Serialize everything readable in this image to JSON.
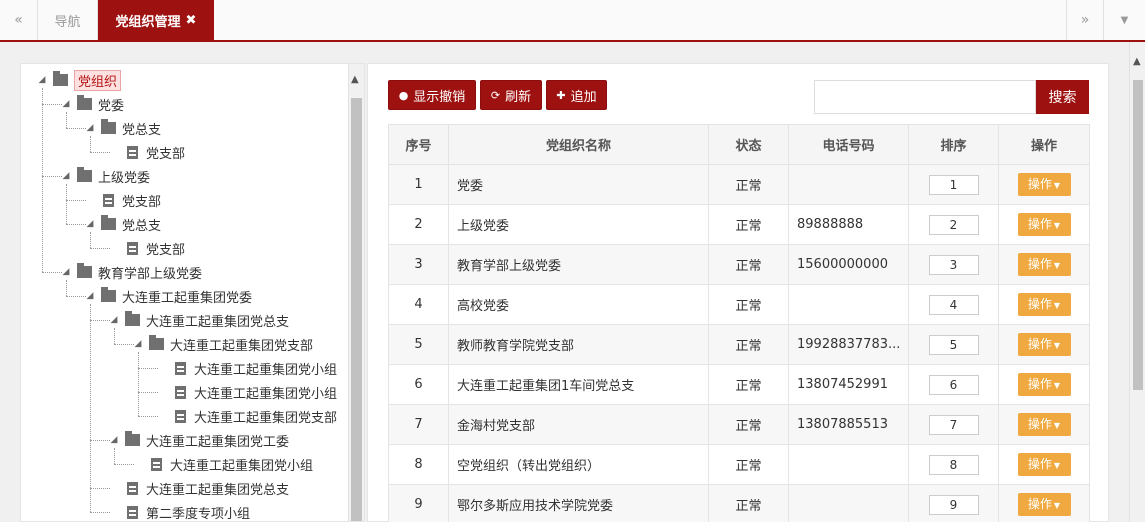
{
  "tabs": {
    "prev": "«",
    "nav": "导航",
    "active": "党组织管理",
    "close": "✖",
    "next": "»",
    "dropdown": "▼"
  },
  "toolbar": {
    "show_revoke": "显示撤销",
    "refresh": "刷新",
    "add": "追加",
    "search": "搜索",
    "search_value": ""
  },
  "tree": {
    "nodes": [
      {
        "label": "党组织",
        "type": "folder",
        "level": 0,
        "selected": true
      },
      {
        "label": "党委",
        "type": "folder",
        "level": 1
      },
      {
        "label": "党总支",
        "type": "folder",
        "level": 2
      },
      {
        "label": "党支部",
        "type": "file",
        "level": 3
      },
      {
        "label": "上级党委",
        "type": "folder",
        "level": 1
      },
      {
        "label": "党支部",
        "type": "file",
        "level": 2
      },
      {
        "label": "党总支",
        "type": "folder",
        "level": 2
      },
      {
        "label": "党支部",
        "type": "file",
        "level": 3
      },
      {
        "label": "教育学部上级党委",
        "type": "folder",
        "level": 1
      },
      {
        "label": "大连重工起重集团党委",
        "type": "folder",
        "level": 2
      },
      {
        "label": "大连重工起重集团党总支",
        "type": "folder",
        "level": 3
      },
      {
        "label": "大连重工起重集团党支部",
        "type": "folder",
        "level": 4
      },
      {
        "label": "大连重工起重集团党小组",
        "type": "file",
        "level": 5
      },
      {
        "label": "大连重工起重集团党小组",
        "type": "file",
        "level": 5
      },
      {
        "label": "大连重工起重集团党支部",
        "type": "file",
        "level": 5
      },
      {
        "label": "大连重工起重集团党工委",
        "type": "folder",
        "level": 3
      },
      {
        "label": "大连重工起重集团党小组",
        "type": "file",
        "level": 4
      },
      {
        "label": "大连重工起重集团党总支",
        "type": "file",
        "level": 3
      },
      {
        "label": "第二季度专项小组",
        "type": "file",
        "level": 3
      }
    ]
  },
  "table": {
    "headers": [
      "序号",
      "党组织名称",
      "状态",
      "电话号码",
      "排序",
      "操作"
    ],
    "op_label": "操作",
    "rows": [
      {
        "no": "1",
        "name": "党委",
        "status": "正常",
        "phone": "",
        "order": "1"
      },
      {
        "no": "2",
        "name": "上级党委",
        "status": "正常",
        "phone": "89888888",
        "order": "2"
      },
      {
        "no": "3",
        "name": "教育学部上级党委",
        "status": "正常",
        "phone": "15600000000",
        "order": "3"
      },
      {
        "no": "4",
        "name": "高校党委",
        "status": "正常",
        "phone": "",
        "order": "4"
      },
      {
        "no": "5",
        "name": "教师教育学院党支部",
        "status": "正常",
        "phone": "19928837783...",
        "order": "5"
      },
      {
        "no": "6",
        "name": "大连重工起重集团1车间党总支",
        "status": "正常",
        "phone": "13807452991",
        "order": "6"
      },
      {
        "no": "7",
        "name": "金海村党支部",
        "status": "正常",
        "phone": "13807885513",
        "order": "7"
      },
      {
        "no": "8",
        "name": "空党组织（转出党组织）",
        "status": "正常",
        "phone": "",
        "order": "8"
      },
      {
        "no": "9",
        "name": "鄂尔多斯应用技术学院党委",
        "status": "正常",
        "phone": "",
        "order": "9"
      }
    ]
  },
  "colors": {
    "brand": "#9e1111",
    "op_button": "#f0a940"
  }
}
